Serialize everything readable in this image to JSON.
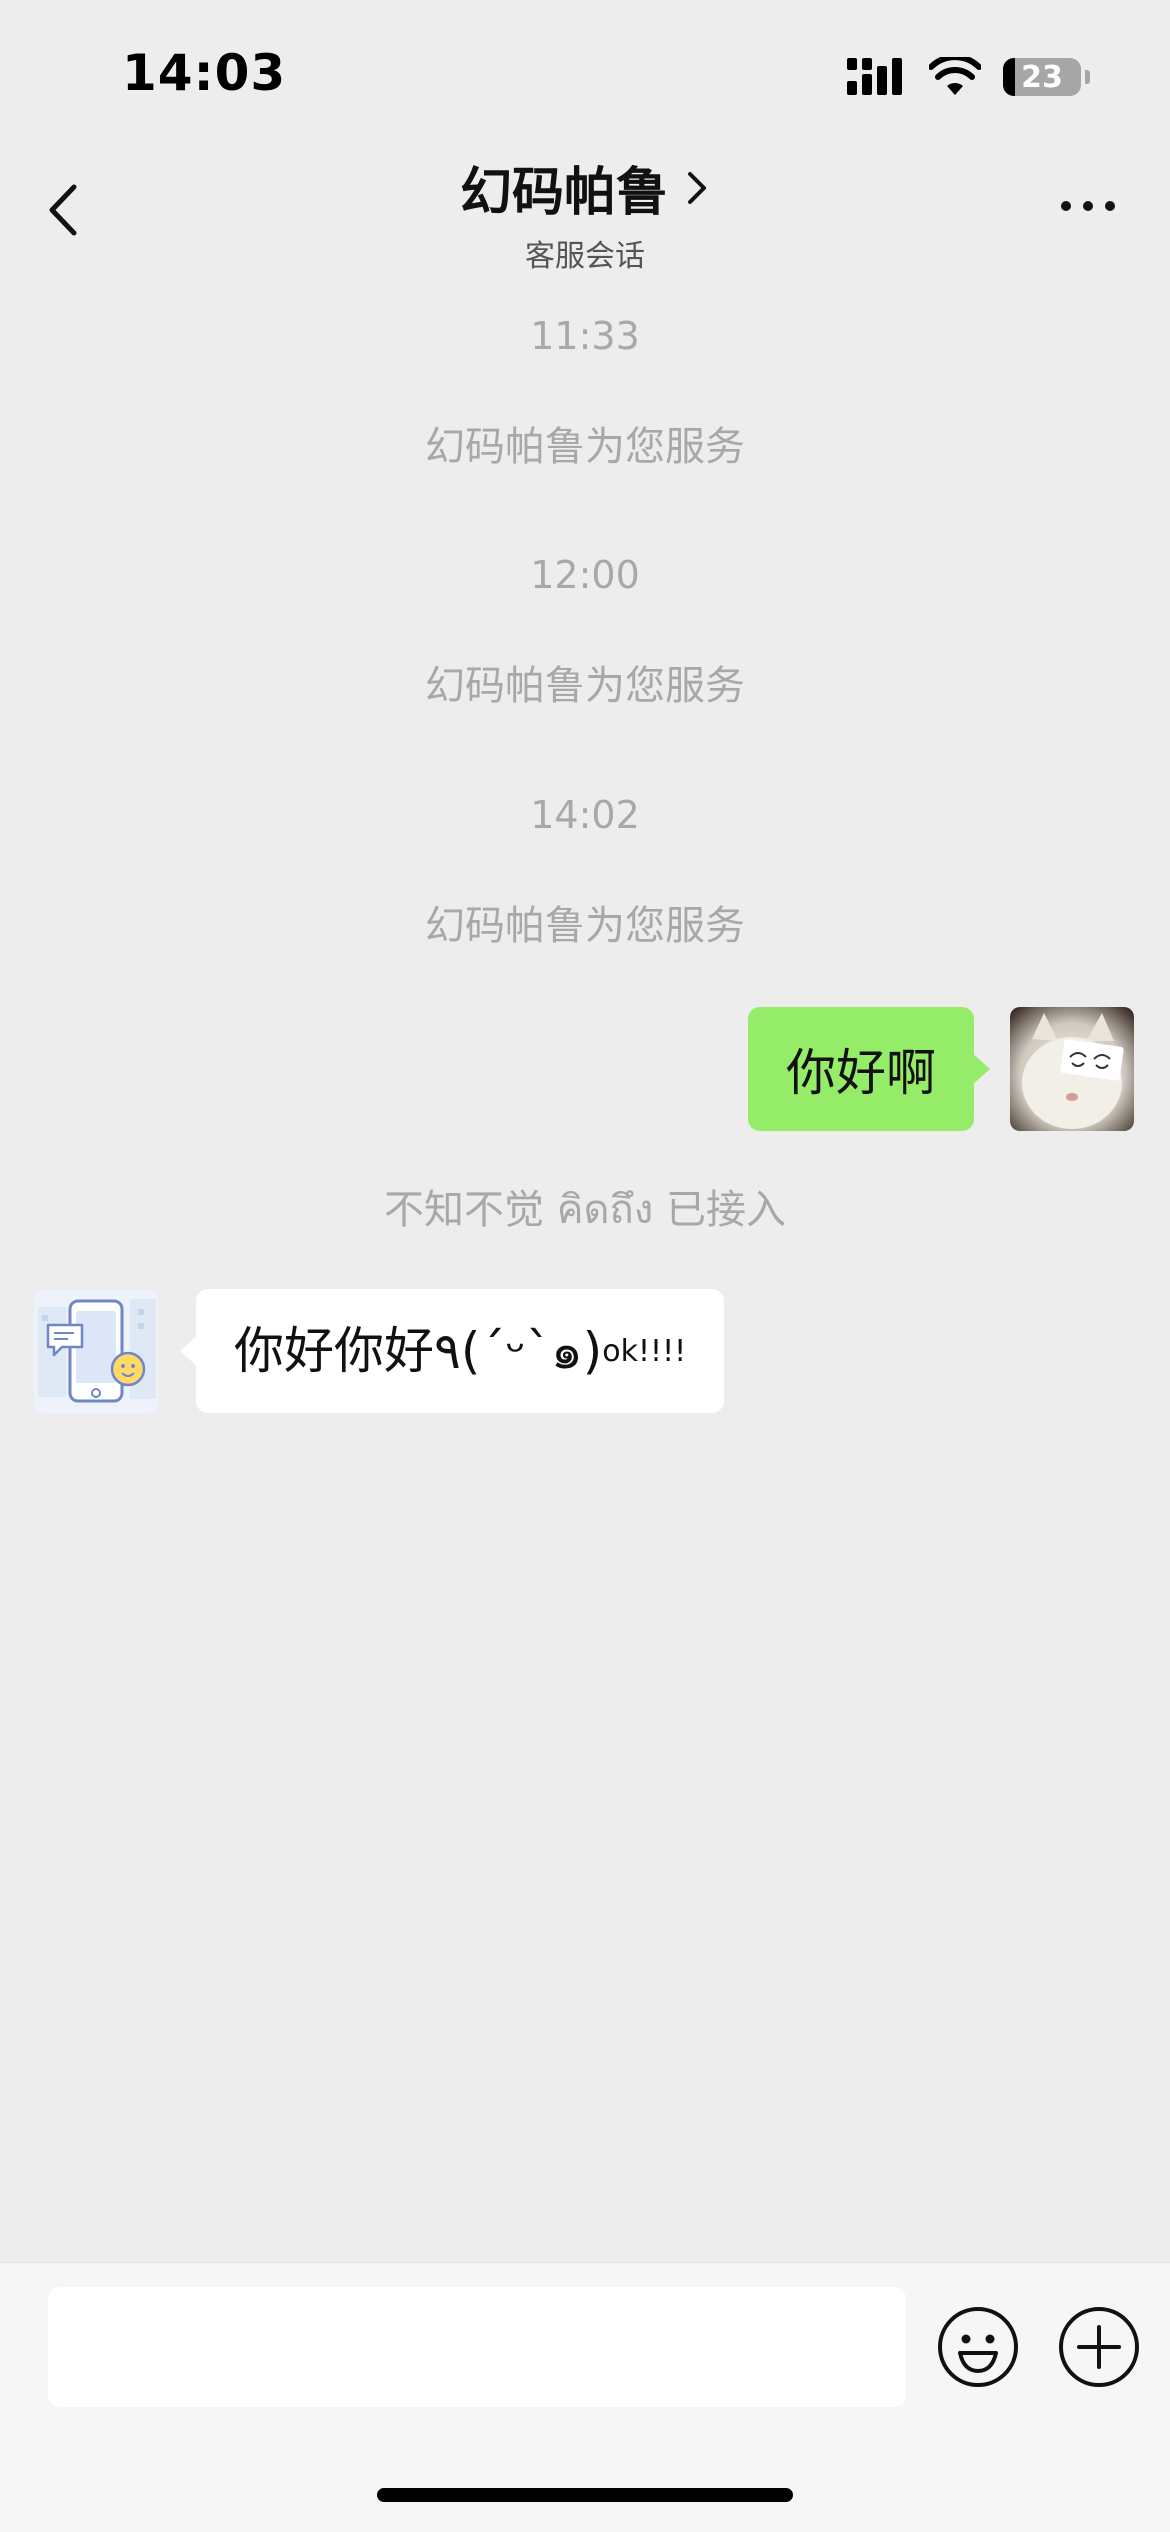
{
  "status_bar": {
    "time": "14:03",
    "battery": "23"
  },
  "nav": {
    "title": "幻码帕鲁",
    "subtitle": "客服会话"
  },
  "messages": [
    {
      "type": "timestamp",
      "text": "11:33"
    },
    {
      "type": "system",
      "text": "幻码帕鲁为您服务"
    },
    {
      "type": "timestamp",
      "text": "12:00"
    },
    {
      "type": "system",
      "text": "幻码帕鲁为您服务"
    },
    {
      "type": "timestamp",
      "text": "14:02"
    },
    {
      "type": "system",
      "text": "幻码帕鲁为您服务"
    },
    {
      "type": "outgoing",
      "text": "你好啊"
    },
    {
      "type": "system",
      "text": "不知不觉 คิดถึง 已接入"
    },
    {
      "type": "incoming",
      "text": "你好你好٩(ˊᵕˋ๑)",
      "suffix": "ok!!!!"
    }
  ],
  "input": {
    "value": ""
  },
  "colors": {
    "background": "#ededed",
    "outgoing_bubble": "#95ec69",
    "incoming_bubble": "#ffffff",
    "muted_text": "#a8a8a8"
  },
  "icons": {
    "back": "chevron-left-icon",
    "title_chevron": "chevron-right-icon",
    "more": "more-dots-icon",
    "emoji": "emoji-icon",
    "plus": "plus-circle-icon"
  }
}
